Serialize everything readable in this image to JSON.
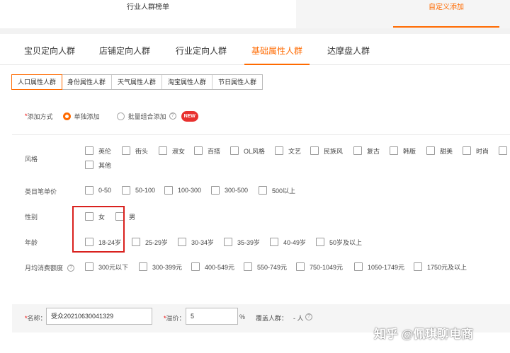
{
  "top_tabs": {
    "left": "行业人群榜单",
    "right": "自定义添加"
  },
  "main_tabs": [
    "宝贝定向人群",
    "店铺定向人群",
    "行业定向人群",
    "基础属性人群",
    "达摩盘人群"
  ],
  "sub_tabs": [
    "人口属性人群",
    "身份属性人群",
    "天气属性人群",
    "淘宝属性人群",
    "节日属性人群"
  ],
  "add_mode": {
    "required_mark": "*",
    "label": "添加方式",
    "option_single": "单独添加",
    "option_batch": "批量组合添加",
    "help": "?",
    "new_badge": "NEW"
  },
  "attributes": {
    "style": {
      "label": "风格",
      "options": [
        "英伦",
        "街头",
        "淑女",
        "百搭",
        "OL风格",
        "文艺",
        "民族风",
        "复古",
        "韩版",
        "甜美",
        "时尚",
        "其他"
      ]
    },
    "price": {
      "label": "类目笔单价",
      "options": [
        "0-50",
        "50-100",
        "100-300",
        "300-500",
        "500以上"
      ]
    },
    "gender": {
      "label": "性别",
      "options": [
        "女",
        "男"
      ]
    },
    "age": {
      "label": "年龄",
      "options": [
        "18-24岁",
        "25-29岁",
        "30-34岁",
        "35-39岁",
        "40-49岁",
        "50岁及以上"
      ]
    },
    "spend": {
      "label": "月均消费额度",
      "help": "?",
      "options": [
        "300元以下",
        "300-399元",
        "400-549元",
        "550-749元",
        "750-1049元",
        "1050-1749元",
        "1750元及以上"
      ]
    }
  },
  "bottom": {
    "name_label": "名称：",
    "name_value": "受众20210630041329",
    "premium_label": "溢价：",
    "premium_value": "5",
    "percent": "%",
    "coverage_label": "覆盖人群：",
    "coverage_value": "- 人",
    "help": "?"
  },
  "watermark": "知乎 @佩琪聊电商",
  "colors": {
    "accent": "#ff6a00",
    "highlight_box": "#d9211e",
    "new_badge": "#e8312f"
  }
}
